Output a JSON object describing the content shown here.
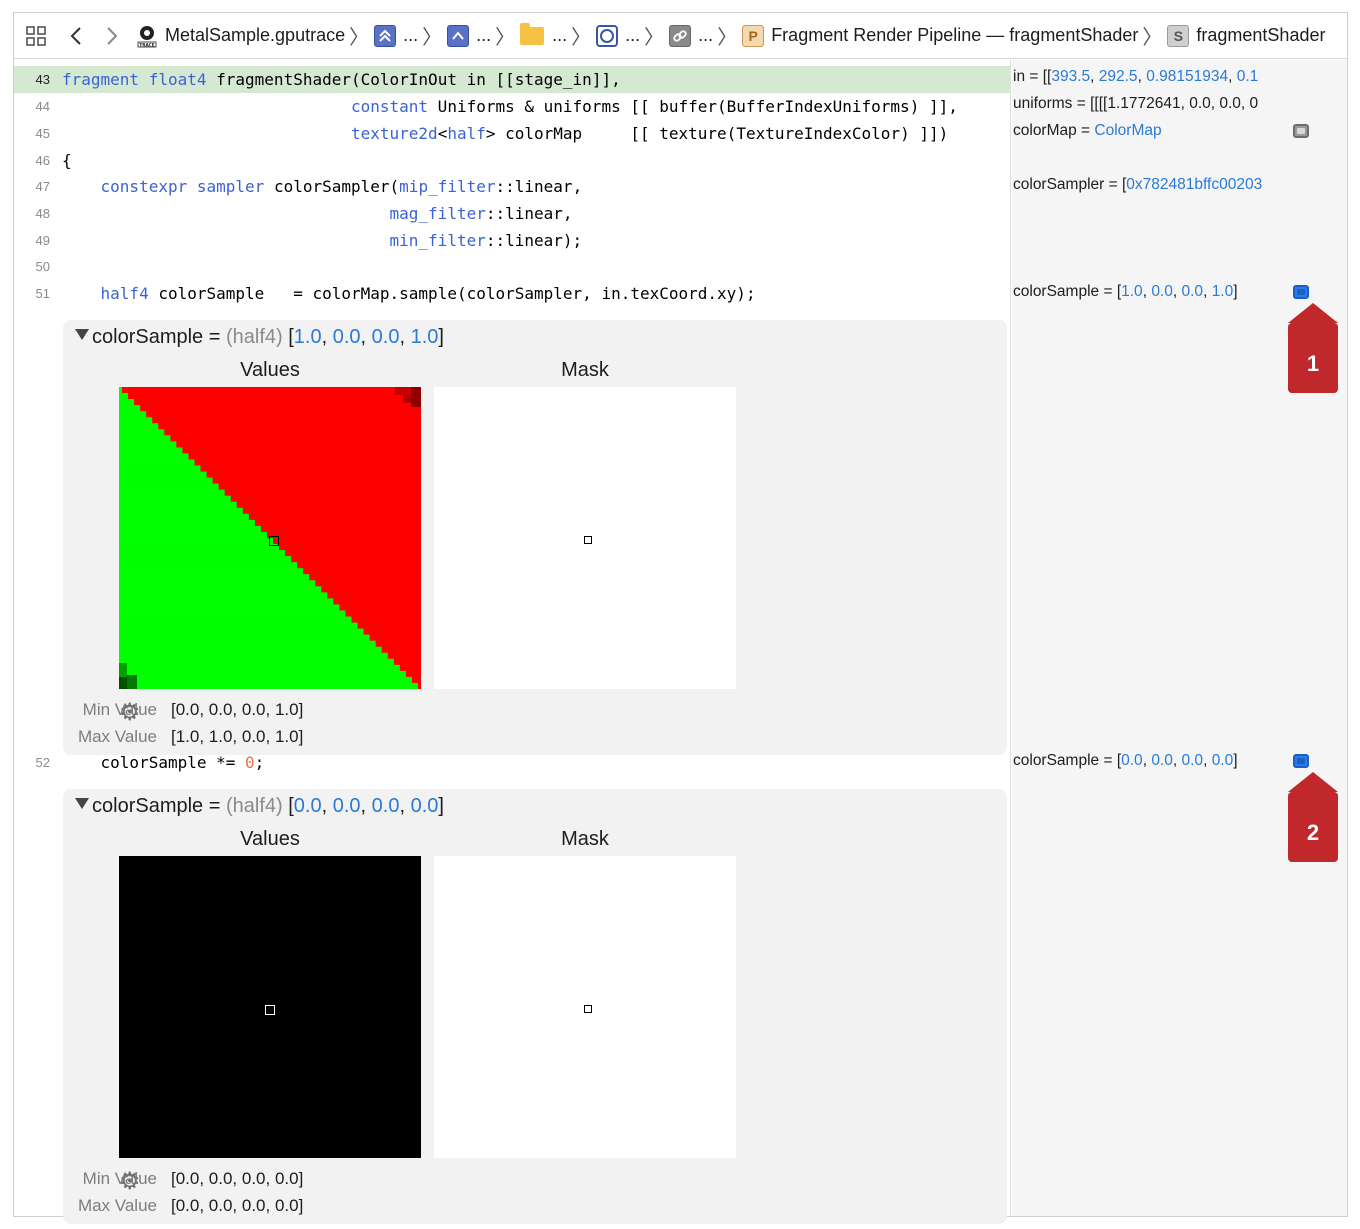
{
  "jumpbar": {
    "file": "MetalSample.gputrace",
    "crumbs": [
      "...",
      "...",
      "...",
      "...",
      "..."
    ],
    "pipeline": "Fragment Render Pipeline — fragmentShader",
    "shader": "fragmentShader",
    "icons": [
      "related-items-icon",
      "back-chevron-icon",
      "forward-chevron-icon",
      "gputrace-file-icon",
      "command-buffer-icon",
      "encoder-icon",
      "folder-icon",
      "draw-call-icon",
      "link-icon",
      "pipeline-icon",
      "shader-icon"
    ]
  },
  "code": {
    "lines": [
      {
        "n": "43",
        "parts": [
          [
            "kw",
            "fragment"
          ],
          [
            "t",
            " "
          ],
          [
            "kw",
            "float4"
          ],
          [
            "t",
            " fragmentShader(ColorInOut in [[stage_in]],"
          ]
        ]
      },
      {
        "n": "44",
        "parts": [
          [
            "t",
            "                              "
          ],
          [
            "kw",
            "constant"
          ],
          [
            "t",
            " Uniforms & uniforms [[ buffer(BufferIndexUniforms) ]],"
          ]
        ]
      },
      {
        "n": "45",
        "parts": [
          [
            "t",
            "                              "
          ],
          [
            "kw",
            "texture2d"
          ],
          [
            "t",
            "<"
          ],
          [
            "kw",
            "half"
          ],
          [
            "t",
            "> colorMap     [[ texture(TextureIndexColor) ]])"
          ]
        ]
      },
      {
        "n": "46",
        "parts": [
          [
            "t",
            "{"
          ]
        ]
      },
      {
        "n": "47",
        "parts": [
          [
            "t",
            "    "
          ],
          [
            "kw",
            "constexpr"
          ],
          [
            "t",
            " "
          ],
          [
            "kw",
            "sampler"
          ],
          [
            "t",
            " colorSampler("
          ],
          [
            "kw",
            "mip_filter"
          ],
          [
            "t",
            "::linear,"
          ]
        ]
      },
      {
        "n": "48",
        "parts": [
          [
            "t",
            "                                  "
          ],
          [
            "kw",
            "mag_filter"
          ],
          [
            "t",
            "::linear,"
          ]
        ]
      },
      {
        "n": "49",
        "parts": [
          [
            "t",
            "                                  "
          ],
          [
            "kw",
            "min_filter"
          ],
          [
            "t",
            "::linear);"
          ]
        ]
      },
      {
        "n": "50",
        "parts": [
          [
            "t",
            ""
          ]
        ]
      },
      {
        "n": "51",
        "parts": [
          [
            "t",
            "    "
          ],
          [
            "kw",
            "half4"
          ],
          [
            "t",
            " colorSample   = colorMap.sample(colorSampler, in.texCoord.xy);"
          ]
        ]
      },
      {
        "n": "52",
        "parts": [
          [
            "t",
            "    colorSample *= "
          ],
          [
            "num",
            "0"
          ],
          [
            "t",
            ";"
          ]
        ]
      }
    ]
  },
  "panels": [
    {
      "var": "colorSample",
      "eq": " = ",
      "type": "(half4)",
      "open": " [",
      "vals": [
        "1.0",
        "0.0",
        "0.0",
        "1.0"
      ],
      "close": "]",
      "values_label": "Values",
      "mask_label": "Mask",
      "min_label": "Min Value",
      "min_value": "[0.0, 0.0, 0.0, 1.0]",
      "max_label": "Max Value",
      "max_value": "[1.0, 1.0, 0.0, 1.0]",
      "texture": "red-green-diagonal"
    },
    {
      "var": "colorSample",
      "eq": " = ",
      "type": "(half4)",
      "open": " [",
      "vals": [
        "0.0",
        "0.0",
        "0.0",
        "0.0"
      ],
      "close": "]",
      "values_label": "Values",
      "mask_label": "Mask",
      "min_label": "Min Value",
      "min_value": "[0.0, 0.0, 0.0, 0.0]",
      "max_label": "Max Value",
      "max_value": "[0.0, 0.0, 0.0, 0.0]",
      "texture": "black"
    }
  ],
  "aside": {
    "in_prefix": "in = [[",
    "in_vals": [
      "393.5",
      "292.5",
      "0.98151934",
      "0.1"
    ],
    "uniforms": "uniforms = [[[[1.1772641, 0.0, 0.0, 0",
    "colormap_prefix": "colorMap = ",
    "colormap_link": "ColorMap",
    "sampler_prefix": "colorSampler = [",
    "sampler_link": "0x782481bffc00203",
    "cs1_prefix": "colorSample = [",
    "cs1_vals": [
      "1.0",
      "0.0",
      "0.0",
      "1.0"
    ],
    "cs2_prefix": "colorSample = [",
    "cs2_vals": [
      "0.0",
      "0.0",
      "0.0",
      "0.0"
    ],
    "close": "]",
    "sep": ", "
  },
  "callouts": [
    "1",
    "2"
  ],
  "colors": {
    "keyword": "#3a63d6",
    "value": "#2a7ad6",
    "literal": "#e8704a",
    "highlight": "#d4e8d2",
    "red": "#ff0000",
    "green": "#00ff00",
    "callout": "#c0282c"
  }
}
